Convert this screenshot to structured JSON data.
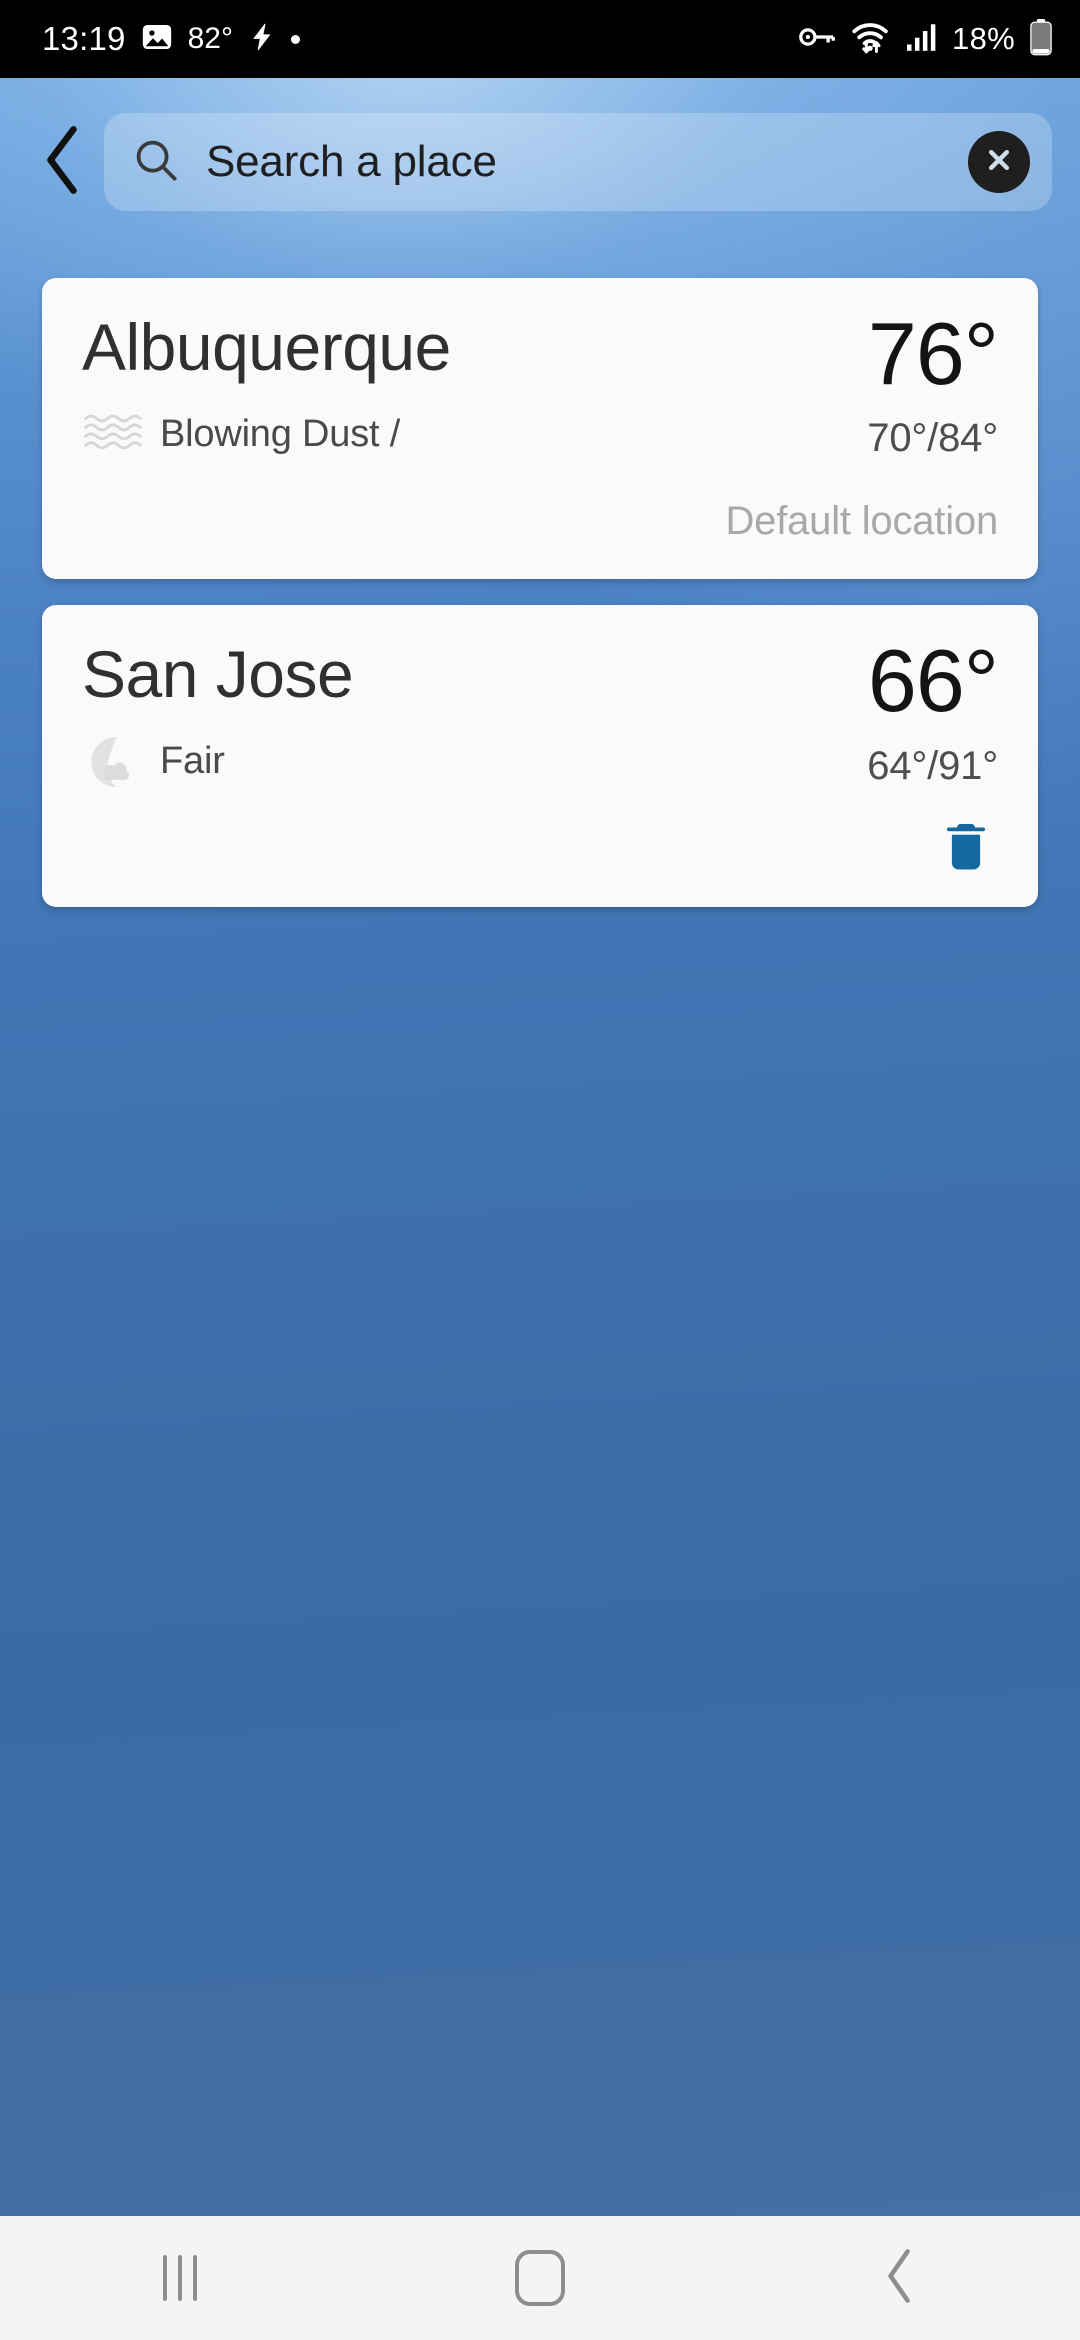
{
  "status_bar": {
    "time": "13:19",
    "weather_temp": "82°",
    "battery_percent": "18%",
    "icons": {
      "photo": "photo-icon",
      "lightning": "lightning-bolt-icon",
      "dot": "dot-indicator-icon",
      "vpn": "vpn-key-icon",
      "wifi": "wifi-transfer-icon",
      "signal": "cellular-signal-icon",
      "battery": "battery-low-icon"
    }
  },
  "search": {
    "placeholder": "Search a place",
    "value": "",
    "back_icon": "chevron-left-icon",
    "search_icon": "search-icon",
    "clear_icon": "close-circle-icon"
  },
  "locations": [
    {
      "city": "Albuquerque",
      "condition": "Blowing Dust /",
      "condition_icon": "blowing-dust-icon",
      "temp_now": "76°",
      "temp_range": "70°/84°",
      "footer_note": "Default location",
      "has_delete": false
    },
    {
      "city": "San Jose",
      "condition": "Fair",
      "condition_icon": "moon-cloud-night-fair-icon",
      "temp_now": "66°",
      "temp_range": "64°/91°",
      "footer_note": "",
      "has_delete": true,
      "delete_icon": "trash-delete-icon"
    }
  ],
  "nav_bar": {
    "recents_label": "recents-icon",
    "home_label": "home-icon",
    "back_label": "back-icon"
  },
  "colors": {
    "accent_blue": "#1569a0",
    "card_bg": "#fafafa",
    "background_blue": "#4076b6",
    "status_bar_bg": "#000000"
  }
}
